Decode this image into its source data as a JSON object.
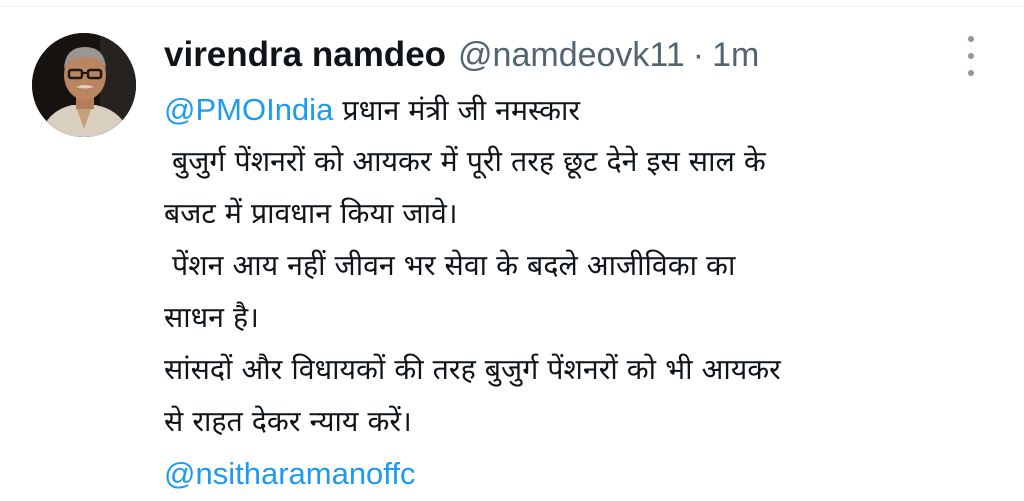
{
  "tweet": {
    "author": {
      "display_name": "virendra namdeo",
      "handle": "@namdeovk11",
      "separator": "·",
      "time": "1m"
    },
    "lines": [
      {
        "mention": "@PMOIndia",
        "text": " प्रधान मंत्री जी नमस्कार"
      },
      {
        "mention": "",
        "text": "बुजुर्ग पेंशनरों को आयकर में पूरी तरह छूट देने इस साल के"
      },
      {
        "mention": "",
        "text": "बजट में प्रावधान किया जावे।"
      },
      {
        "mention": "",
        "text": "पेंशन आय नहीं जीवन भर सेवा के बदले आजीविका का"
      },
      {
        "mention": "",
        "text": "साधन है।"
      },
      {
        "mention": "",
        "text": "सांसदों और विधायकों की तरह बुजुर्ग पेंशनरों को भी आयकर"
      },
      {
        "mention": "",
        "text": "से राहत देकर न्याय करें।"
      },
      {
        "mention": "@nsitharamanoffc",
        "text": ""
      }
    ],
    "more_icon": "more-vertical-icon"
  },
  "colors": {
    "text": "#0f1419",
    "secondary": "#536471",
    "link": "#1d9bf0",
    "background": "#ffffff"
  }
}
